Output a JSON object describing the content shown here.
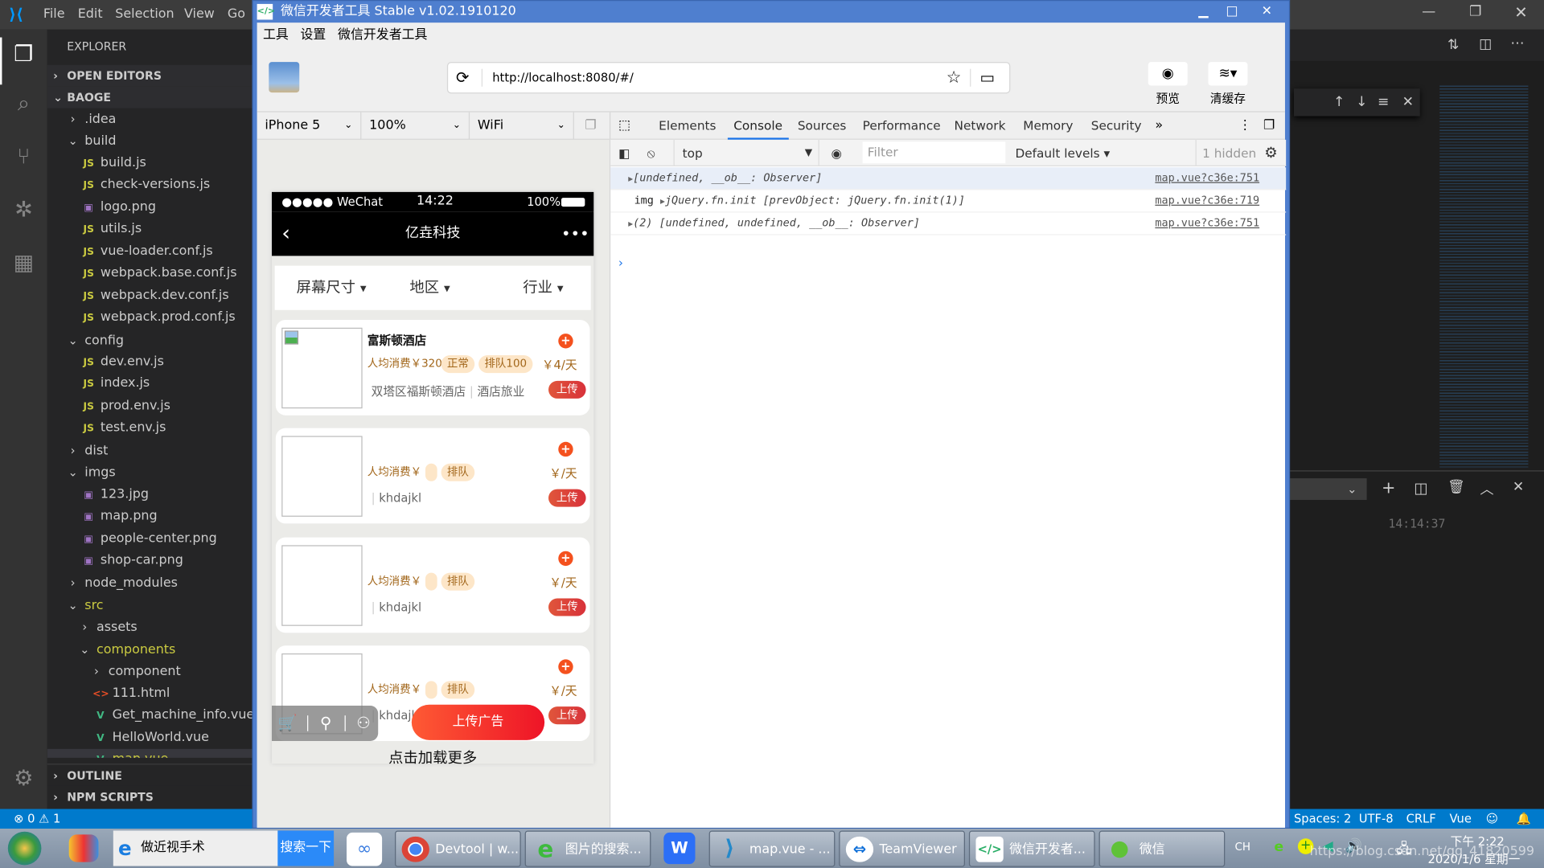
{
  "vscode": {
    "menu": [
      "File",
      "Edit",
      "Selection",
      "View",
      "Go"
    ],
    "explorer_title": "EXPLORER",
    "open_editors": "OPEN EDITORS",
    "workspace": "BAOGE",
    "tree": [
      {
        "label": ".idea",
        "type": "folder-closed",
        "level": 1
      },
      {
        "label": "build",
        "type": "folder-open",
        "level": 1
      },
      {
        "label": "build.js",
        "type": "js",
        "level": 2
      },
      {
        "label": "check-versions.js",
        "type": "js",
        "level": 2
      },
      {
        "label": "logo.png",
        "type": "img",
        "level": 2
      },
      {
        "label": "utils.js",
        "type": "js",
        "level": 2
      },
      {
        "label": "vue-loader.conf.js",
        "type": "js",
        "level": 2
      },
      {
        "label": "webpack.base.conf.js",
        "type": "js",
        "level": 2
      },
      {
        "label": "webpack.dev.conf.js",
        "type": "js",
        "level": 2
      },
      {
        "label": "webpack.prod.conf.js",
        "type": "js",
        "level": 2
      },
      {
        "label": "config",
        "type": "folder-open",
        "level": 1
      },
      {
        "label": "dev.env.js",
        "type": "js",
        "level": 2
      },
      {
        "label": "index.js",
        "type": "js",
        "level": 2
      },
      {
        "label": "prod.env.js",
        "type": "js",
        "level": 2
      },
      {
        "label": "test.env.js",
        "type": "js",
        "level": 2
      },
      {
        "label": "dist",
        "type": "folder-closed",
        "level": 1
      },
      {
        "label": "imgs",
        "type": "folder-open",
        "level": 1
      },
      {
        "label": "123.jpg",
        "type": "img",
        "level": 2
      },
      {
        "label": "map.png",
        "type": "img",
        "level": 2
      },
      {
        "label": "people-center.png",
        "type": "img",
        "level": 2
      },
      {
        "label": "shop-car.png",
        "type": "img",
        "level": 2
      },
      {
        "label": "node_modules",
        "type": "folder-closed",
        "level": 1
      },
      {
        "label": "src",
        "type": "folder-open",
        "level": 1,
        "modified": true
      },
      {
        "label": "assets",
        "type": "folder-closed",
        "level": 2
      },
      {
        "label": "components",
        "type": "folder-open",
        "level": 2,
        "modified": true
      },
      {
        "label": "component",
        "type": "folder-closed",
        "level": 3
      },
      {
        "label": "111.html",
        "type": "html",
        "level": 3
      },
      {
        "label": "Get_machine_info.vue",
        "type": "vue",
        "level": 3
      },
      {
        "label": "HelloWorld.vue",
        "type": "vue",
        "level": 3
      },
      {
        "label": "map.vue",
        "type": "vue",
        "level": 3,
        "modified": true,
        "selected": true
      }
    ],
    "outline": "OUTLINE",
    "npm_scripts": "NPM SCRIPTS",
    "status_errors": "0",
    "status_warnings": "1",
    "status_right": [
      "Spaces: 2",
      "UTF-8",
      "CRLF",
      "Vue"
    ],
    "terminal_time": "14:14:37"
  },
  "wechat_devtools": {
    "title": "微信开发者工具 Stable v1.02.1910120",
    "menu": [
      "工具",
      "设置",
      "微信开发者工具"
    ],
    "url": "http://localhost:8080/#/",
    "preview_label": "预览",
    "clear_cache_label": "清缓存",
    "device": "iPhone 5",
    "zoom": "100%",
    "network": "WiFi",
    "tabs": [
      "Elements",
      "Console",
      "Sources",
      "Performance",
      "Network",
      "Memory",
      "Security"
    ],
    "active_tab": "Console",
    "console_context": "top",
    "filter_placeholder": "Filter",
    "levels": "Default levels",
    "hidden_count": "1 hidden",
    "console_lines": [
      {
        "prefix": "",
        "text": "[undefined, __ob__: Observer]",
        "source": "map.vue?c36e:751"
      },
      {
        "prefix": "img",
        "text": "jQuery.fn.init [prevObject: jQuery.fn.init(1)]",
        "source": "map.vue?c36e:719"
      },
      {
        "prefix": "",
        "text": "(2) [undefined, undefined, __ob__: Observer]",
        "source": "map.vue?c36e:751"
      }
    ]
  },
  "phone": {
    "carrier": "●●●●● WeChat",
    "time": "14:22",
    "battery": "100%",
    "nav_title": "亿垚科技",
    "filters": [
      "屏幕尺寸",
      "地区",
      "行业"
    ],
    "cards": [
      {
        "name": "富斯顿酒店",
        "price": "人均消费￥320",
        "tags": [
          "正常",
          "排队100"
        ],
        "address": "双塔区福斯顿酒店",
        "industry": "酒店旅业",
        "rate": "￥4/天",
        "upload": "上传"
      },
      {
        "name": "",
        "price": "人均消费￥",
        "tags": [
          "",
          "排队"
        ],
        "address": "",
        "industry": "khdajkl",
        "rate": "￥/天",
        "upload": "上传"
      },
      {
        "name": "",
        "price": "人均消费￥",
        "tags": [
          "",
          "排队"
        ],
        "address": "",
        "industry": "khdajkl",
        "rate": "￥/天",
        "upload": "上传"
      },
      {
        "name": "",
        "price": "人均消费￥",
        "tags": [
          "",
          "排队"
        ],
        "address": "",
        "industry": "khdajkl",
        "rate": "￥/天",
        "upload": "上传"
      }
    ],
    "upload_ad": "上传广告",
    "load_more": "点击加载更多"
  },
  "taskbar": {
    "search_text": "做近视手术",
    "search_button": "搜索一下",
    "items": [
      {
        "label": "Devtool | w...",
        "icon": "chrome-icon"
      },
      {
        "label": "图片的搜索...",
        "icon": "ie-icon"
      },
      {
        "label": "map.vue - ...",
        "icon": "vscode-icon"
      },
      {
        "label": "TeamViewer",
        "icon": "teamviewer-icon"
      },
      {
        "label": "微信开发者...",
        "icon": "wechat-devtools-icon"
      },
      {
        "label": "微信",
        "icon": "wechat-icon"
      }
    ],
    "ime": "CH",
    "time": "下午 2:22",
    "date": "2020/1/6 星期一",
    "watermark": "https://blog.csdn.net/qq_41820599"
  },
  "colors": {
    "accent": "#007acc",
    "devtools_tab": "#1a73e8",
    "cta": "#f4511e"
  }
}
